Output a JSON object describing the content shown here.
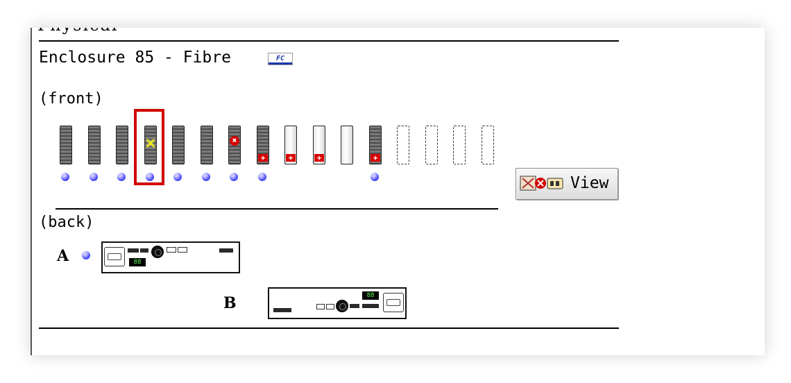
{
  "header": {
    "clipped_title": "Physical",
    "enclosure_title": "Enclosure 85 - Fibre",
    "fc_badge": "FC"
  },
  "front": {
    "label": "(front)",
    "drives": [
      {
        "slot": 1,
        "state": "data",
        "led": true
      },
      {
        "slot": 2,
        "state": "data",
        "led": true
      },
      {
        "slot": 3,
        "state": "data",
        "led": true
      },
      {
        "slot": 4,
        "state": "warning",
        "led": true,
        "selected": true
      },
      {
        "slot": 5,
        "state": "data",
        "led": true
      },
      {
        "slot": 6,
        "state": "data",
        "led": true
      },
      {
        "slot": 7,
        "state": "failed",
        "led": true
      },
      {
        "slot": 8,
        "state": "data-hotspare",
        "led": true
      },
      {
        "slot": 9,
        "state": "spare-hotspare",
        "led": false
      },
      {
        "slot": 10,
        "state": "spare-hotspare",
        "led": false
      },
      {
        "slot": 11,
        "state": "spare",
        "led": false
      },
      {
        "slot": 12,
        "state": "data-hotspare",
        "led": true
      },
      {
        "slot": 13,
        "state": "empty",
        "led": false
      },
      {
        "slot": 14,
        "state": "empty",
        "led": false
      },
      {
        "slot": 15,
        "state": "empty",
        "led": false
      },
      {
        "slot": 16,
        "state": "empty",
        "led": false
      }
    ],
    "glyphs": {
      "hotspare": "+",
      "failed": "✖",
      "warning": "✕"
    }
  },
  "view_button": {
    "label": "View",
    "icon": "fan-failed-controller-icon"
  },
  "back": {
    "label": "(back)",
    "canister_a": {
      "letter": "A",
      "digits": "88"
    },
    "canister_b": {
      "letter": "B",
      "digits": "88"
    }
  },
  "colors": {
    "highlight": "#d10000",
    "led": "#5454ff",
    "fail": "#d40000",
    "hotspare": "#d90000"
  }
}
